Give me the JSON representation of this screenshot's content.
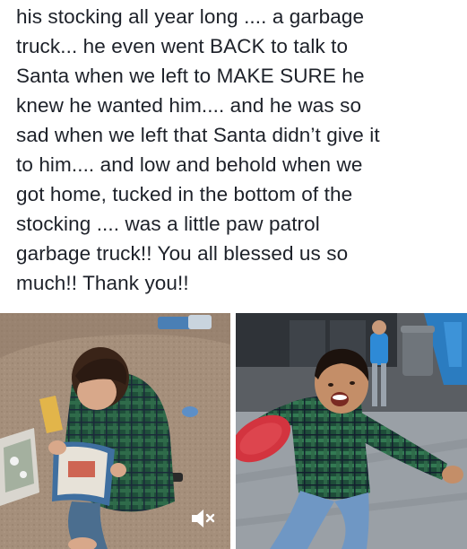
{
  "post": {
    "text_lines": [
      "his stocking all year long .... a garbage",
      "truck... he even went BACK to talk to",
      "Santa when we left to MAKE SURE he",
      "knew he wanted him.... and he was so",
      "sad when we left that Santa didn’t give it",
      "to him.... and low and behold when we",
      "got home, tucked in the bottom of the",
      "stocking .... was a little paw patrol",
      "garbage truck!! You all blessed us so",
      "much!! Thank you!!"
    ]
  },
  "media": {
    "left_video": {
      "icons": [
        "muted-speaker-icon"
      ]
    },
    "right_photo": {}
  },
  "colors": {
    "text": "#1d2129",
    "carpet": "#a58f7b",
    "plaid_green": "#2f6b4a",
    "red_disc": "#d3343f",
    "sky_blue": "#2b7cc0"
  }
}
